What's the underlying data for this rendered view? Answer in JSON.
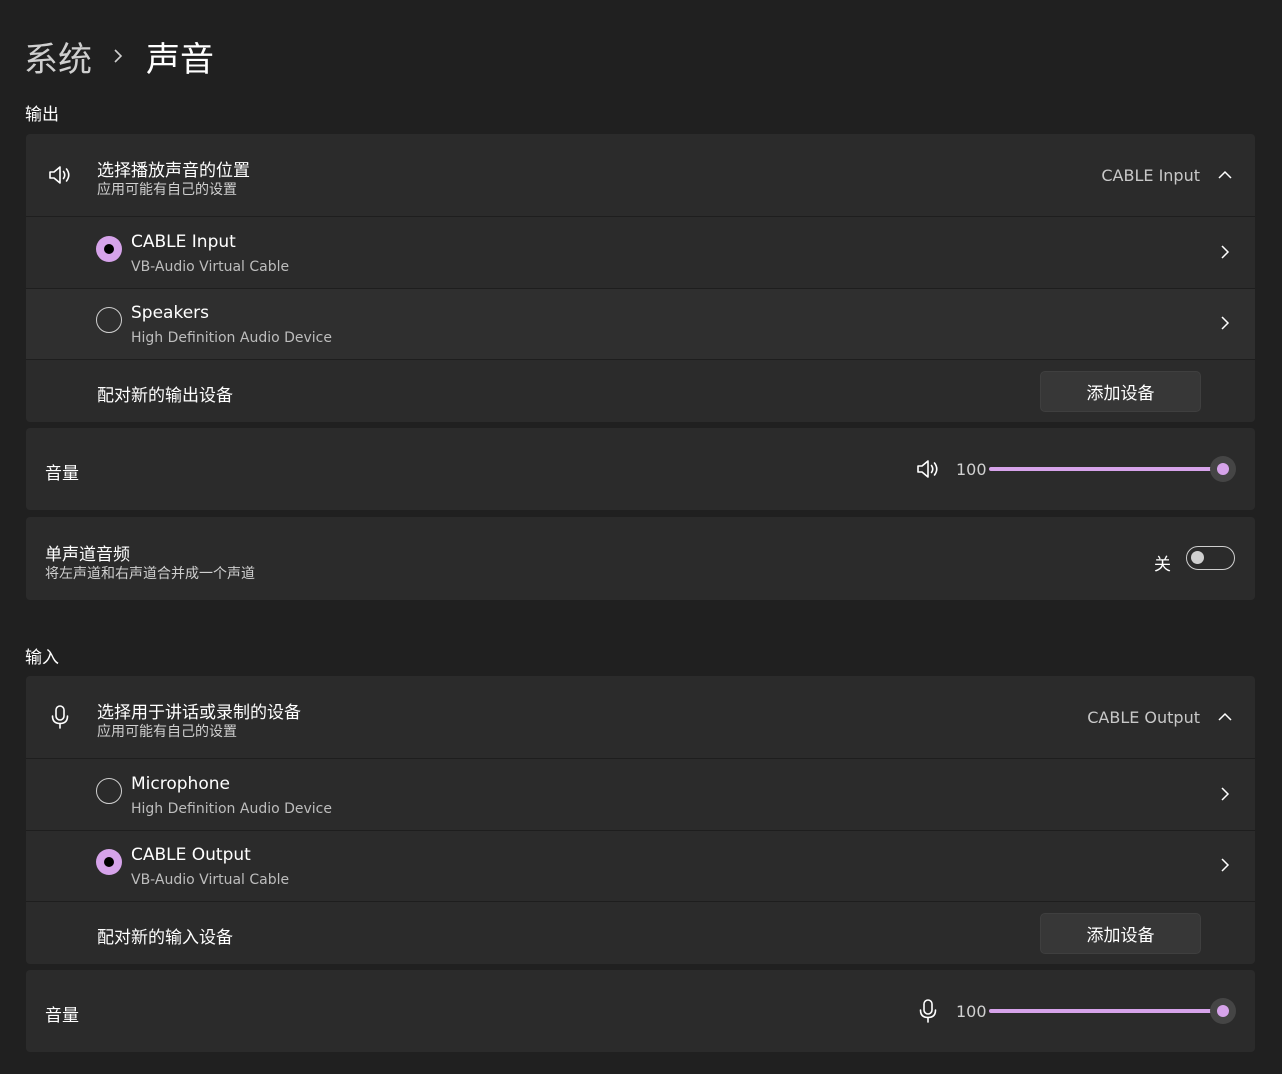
{
  "breadcrumb": {
    "parent": "系统",
    "current": "声音"
  },
  "output": {
    "section_label": "输出",
    "selector": {
      "title": "选择播放声音的位置",
      "subtitle": "应用可能有自己的设置",
      "value": "CABLE Input",
      "icon": "speaker-icon"
    },
    "devices": [
      {
        "name": "CABLE Input",
        "description": "VB-Audio Virtual Cable",
        "selected": true
      },
      {
        "name": "Speakers",
        "description": "High Definition Audio Device",
        "selected": false
      }
    ],
    "pair_label": "配对新的输出设备",
    "add_button": "添加设备",
    "volume": {
      "label": "音量",
      "value": "100",
      "level": 1.0,
      "icon": "speaker-icon"
    },
    "mono": {
      "title": "单声道音频",
      "subtitle": "将左声道和右声道合并成一个声道",
      "state_label": "关",
      "on": false
    }
  },
  "input": {
    "section_label": "输入",
    "selector": {
      "title": "选择用于讲话或录制的设备",
      "subtitle": "应用可能有自己的设置",
      "value": "CABLE Output",
      "icon": "microphone-icon"
    },
    "devices": [
      {
        "name": "Microphone",
        "description": "High Definition Audio Device",
        "selected": false
      },
      {
        "name": "CABLE Output",
        "description": "VB-Audio Virtual Cable",
        "selected": true
      }
    ],
    "pair_label": "配对新的输入设备",
    "add_button": "添加设备",
    "volume": {
      "label": "音量",
      "value": "100",
      "level": 1.0,
      "icon": "microphone-icon"
    }
  },
  "colors": {
    "accent": "#d6a3ea",
    "background": "#202020",
    "card": "#2b2b2b"
  }
}
